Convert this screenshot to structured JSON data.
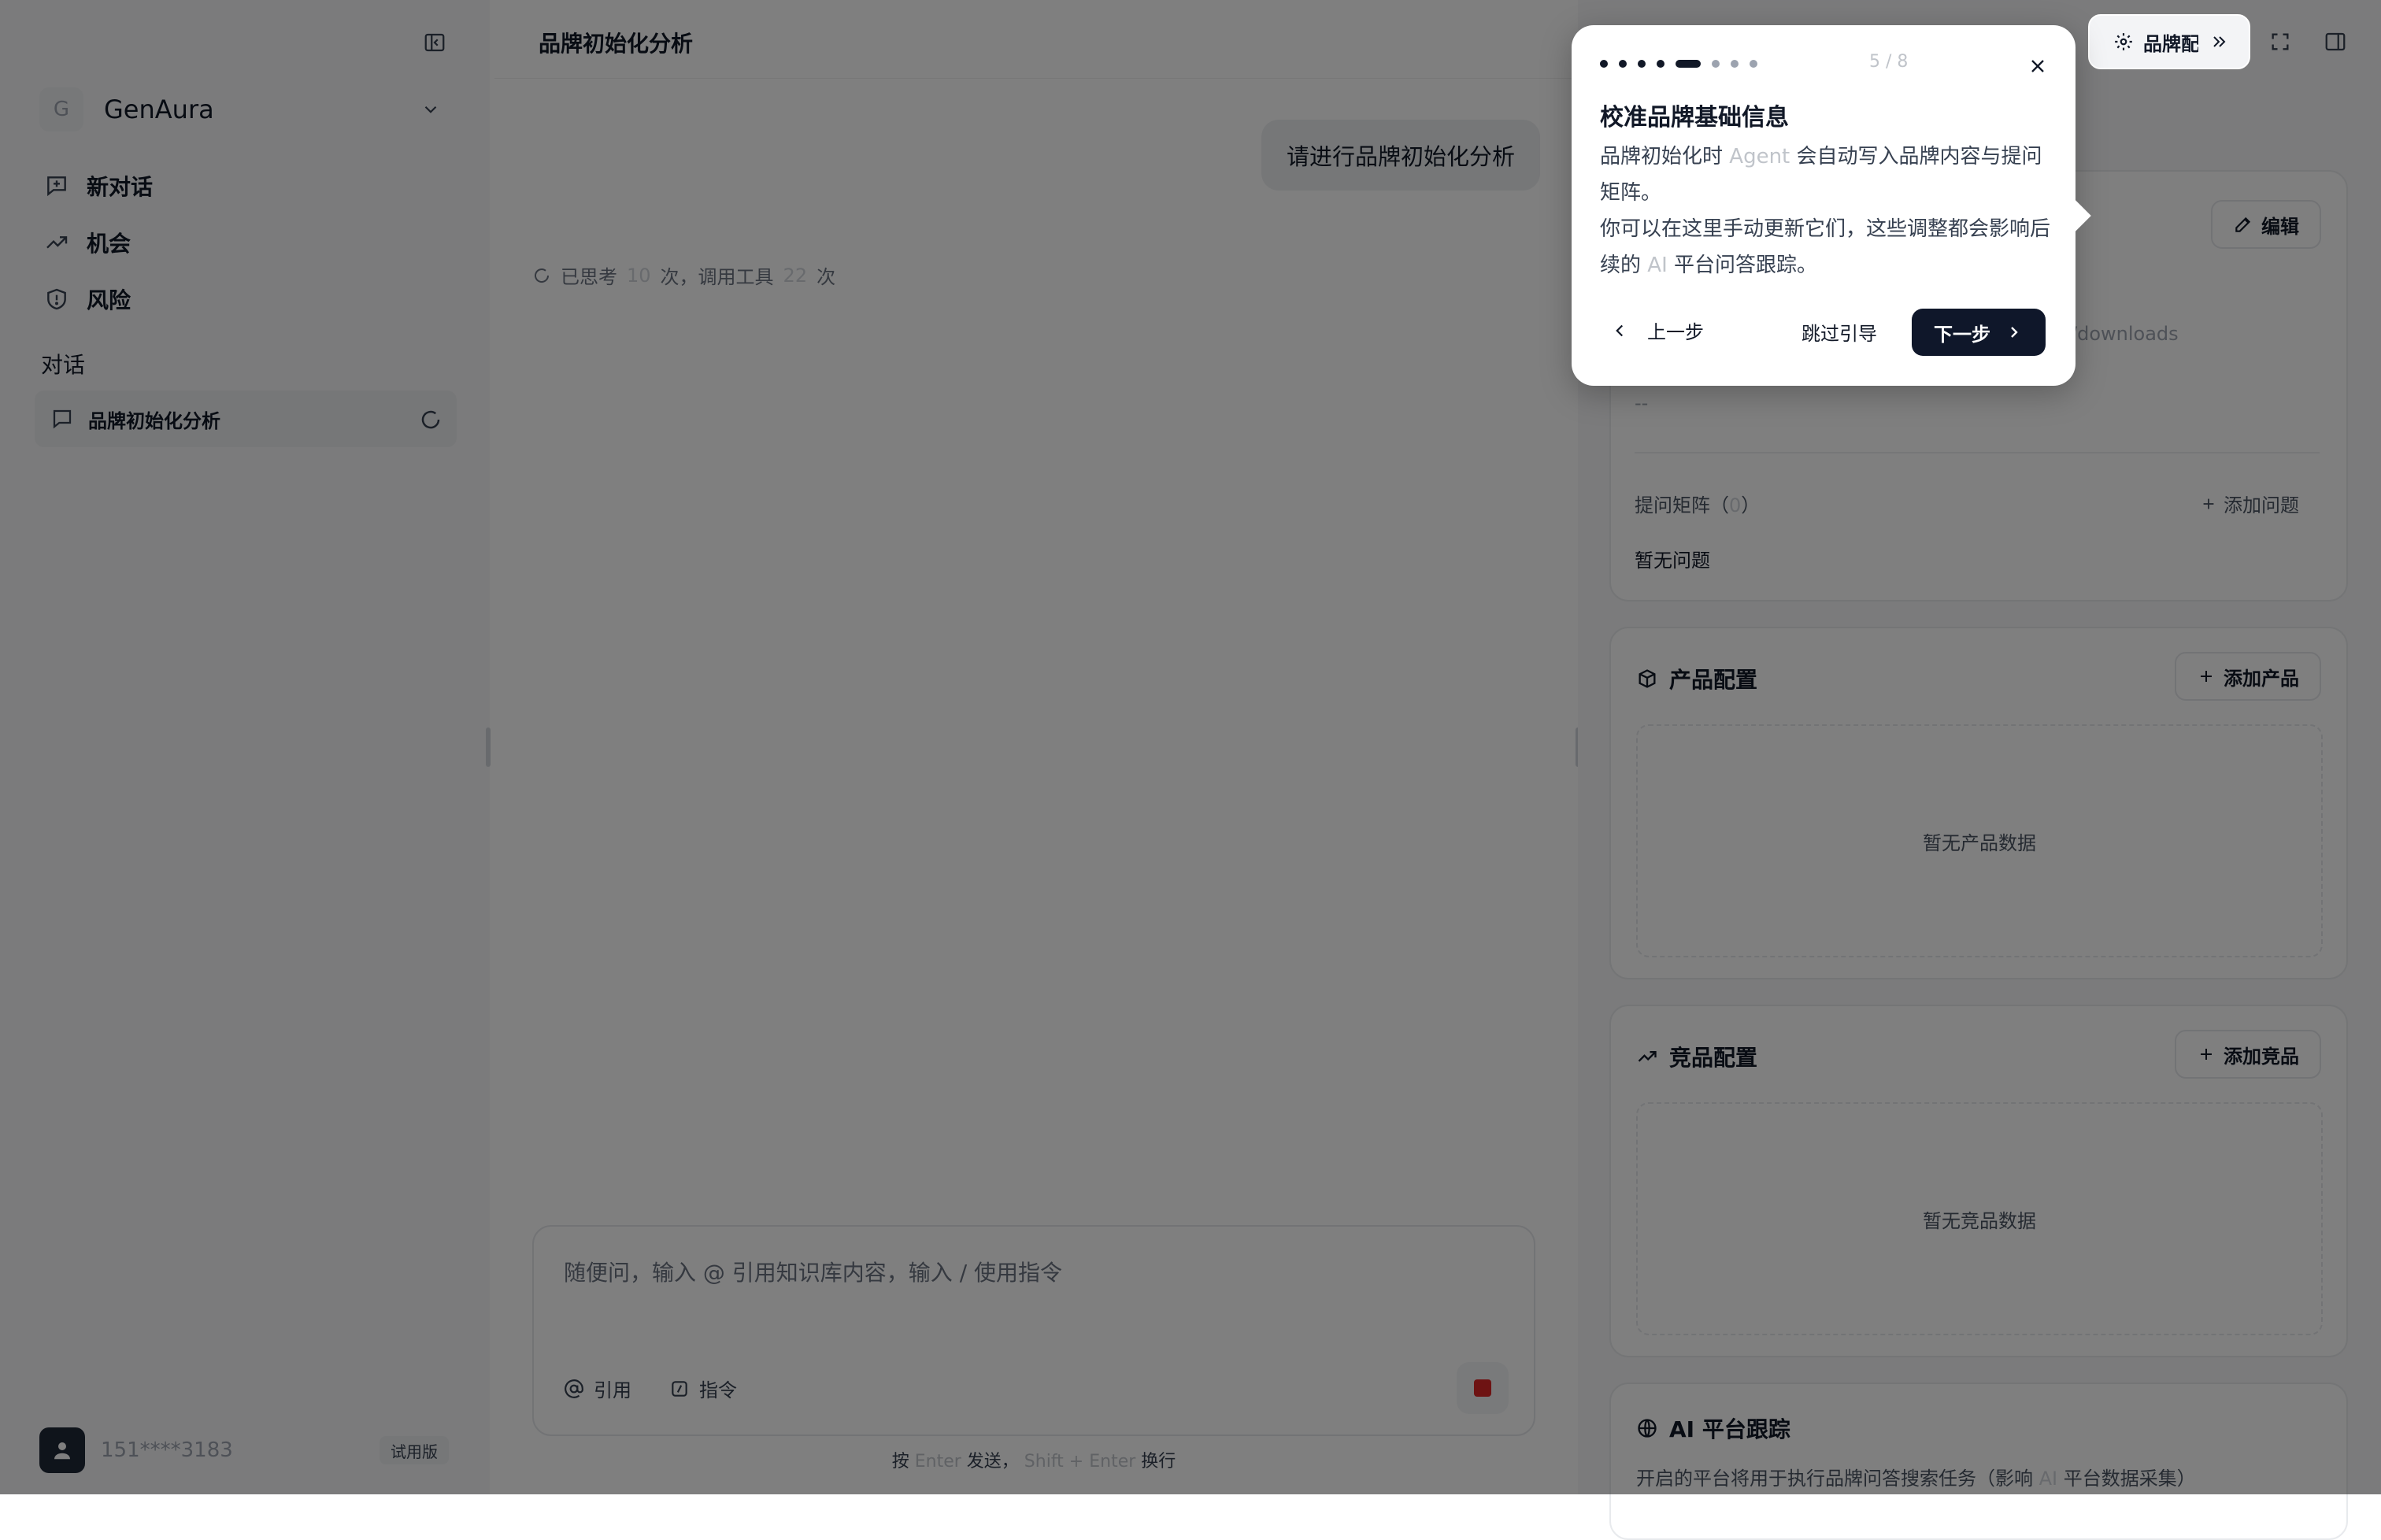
{
  "sidebar": {
    "workspace": {
      "initial": "G",
      "name": "GenAura"
    },
    "nav": [
      {
        "label": "新对话",
        "icon": "new-chat-icon"
      },
      {
        "label": "机会",
        "icon": "trending-up-icon"
      },
      {
        "label": "风险",
        "icon": "shield-icon"
      }
    ],
    "section_label": "对话",
    "conversations": [
      {
        "label": "品牌初始化分析"
      }
    ],
    "user": {
      "phone": "151****3183",
      "plan": "试用版"
    }
  },
  "chat": {
    "title": "品牌初始化分析",
    "user_message": "请进行品牌初始化分析",
    "thinking": {
      "prefix": "已思考",
      "count_think": "10",
      "mid": "次，调用工具",
      "count_tools": "22",
      "suffix": "次"
    },
    "composer": {
      "placeholder": "随便问，输入 @ 引用知识库内容，输入 / 使用指令",
      "quote_label": "引用",
      "command_label": "指令"
    },
    "hint": {
      "a": "按",
      "enter": "Enter",
      "b": "发送，",
      "shift_enter": "Shift + Enter",
      "c": "换行"
    }
  },
  "right": {
    "brand_tab": "品牌配置",
    "brand_card": {
      "edit_label": "编辑",
      "url_fragment": "/downloads",
      "dash": "--",
      "matrix_label": "提问矩阵（",
      "matrix_count": "0",
      "matrix_close": "）",
      "add_question": "添加问题",
      "no_question": "暂无问题"
    },
    "product_card": {
      "title": "产品配置",
      "add": "添加产品",
      "empty": "暂无产品数据"
    },
    "competitor_card": {
      "title": "竞品配置",
      "add": "添加竞品",
      "empty": "暂无竞品数据"
    },
    "platform_card": {
      "title": "AI 平台跟踪",
      "desc_a": "开启的平台将用于执行品牌问答搜索任务（影响",
      "desc_ai": "AI",
      "desc_b": "平台数据采集）"
    }
  },
  "tour": {
    "total_dots": 8,
    "current": 5,
    "step_text": "5 / 8",
    "title": "校准品牌基础信息",
    "line1_a": "品牌初始化时",
    "line1_agent": "Agent",
    "line1_b": "会自动写入品牌内容与提问矩阵。",
    "line2_a": "你可以在这里手动更新它们，这些调整都会影响后续的",
    "line2_ai": "AI",
    "line2_b": "平台问答跟踪。",
    "prev": "上一步",
    "skip": "跳过引导",
    "next": "下一步"
  },
  "colors": {
    "accent": "#0f172a",
    "stop": "#dc2626",
    "overlay": "rgba(0,0,0,0.5)"
  }
}
